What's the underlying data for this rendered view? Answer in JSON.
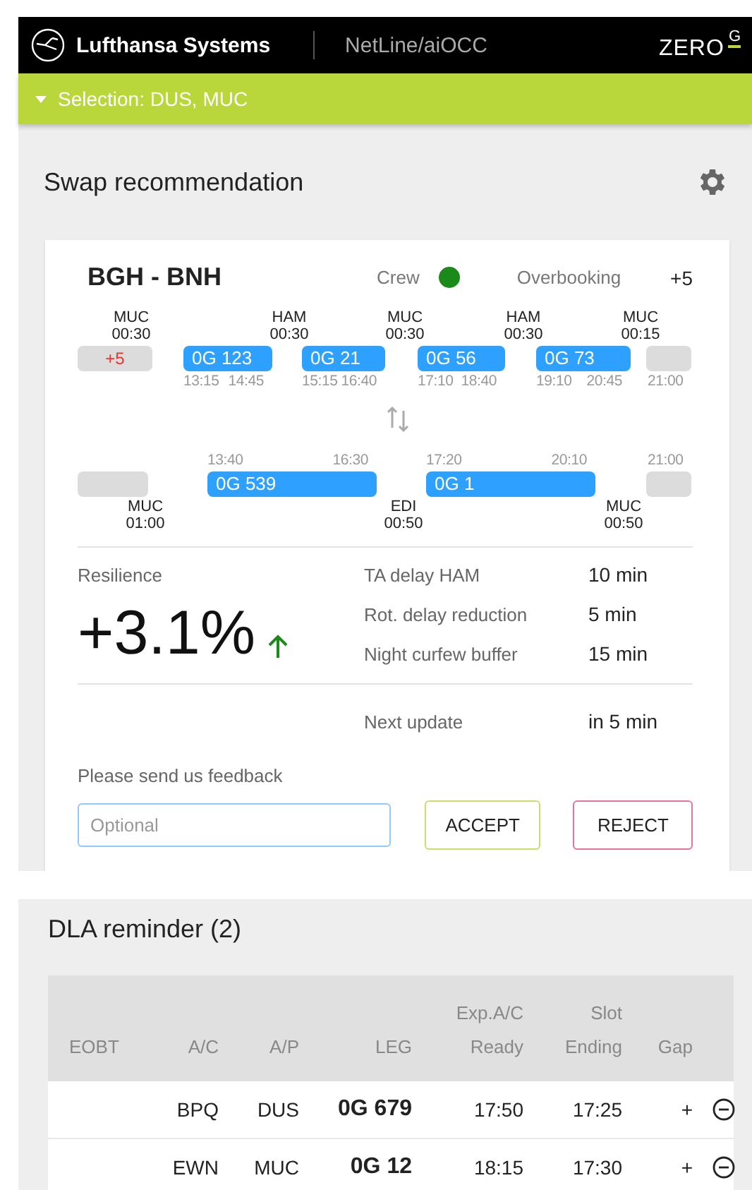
{
  "header": {
    "brand": "Lufthansa Systems",
    "product": "NetLine/aiOCC",
    "logo_text": "ZERO",
    "logo_mark": "G"
  },
  "selection_bar": {
    "label": "Selection: DUS, MUC",
    "expanded": true
  },
  "swap_panel": {
    "title": "Swap recommendation",
    "card": {
      "route": "BGH - BNH",
      "crew": {
        "label": "Crew",
        "color": "#1a8a1a"
      },
      "overbooking_label": "Overbooking",
      "overbooking_value": "+5",
      "top_rotation": {
        "start_badge": "+5",
        "end_time": "21:00",
        "stations": [
          {
            "code": "MUC",
            "time": "00:30"
          },
          {
            "code": "HAM",
            "time": "00:30"
          },
          {
            "code": "MUC",
            "time": "00:30"
          },
          {
            "code": "HAM",
            "time": "00:30"
          },
          {
            "code": "MUC",
            "time": "00:15"
          }
        ],
        "flights": [
          {
            "number": "0G 123",
            "dep": "13:15",
            "arr": "14:45"
          },
          {
            "number": "0G 21",
            "dep": "15:15",
            "arr": "16:40"
          },
          {
            "number": "0G 56",
            "dep": "17:10",
            "arr": "18:40"
          },
          {
            "number": "0G 73",
            "dep": "19:10",
            "arr": "20:45"
          }
        ]
      },
      "bottom_rotation": {
        "end_time": "21:00",
        "stations": [
          {
            "code": "MUC",
            "time": "01:00"
          },
          {
            "code": "EDI",
            "time": "00:50"
          },
          {
            "code": "MUC",
            "time": "00:50"
          }
        ],
        "flights": [
          {
            "number": "0G 539",
            "dep": "13:40",
            "arr": "16:30"
          },
          {
            "number": "0G 1",
            "dep": "17:20",
            "arr": "20:10"
          }
        ]
      },
      "resilience_label": "Resilience",
      "resilience_value": "+3.1%",
      "metrics": [
        {
          "label": "TA delay HAM",
          "value": "10 min"
        },
        {
          "label": "Rot. delay reduction",
          "value": "5 min"
        },
        {
          "label": "Night curfew buffer",
          "value": "15 min"
        }
      ],
      "next_update": {
        "label": "Next update",
        "value": "in 5 min"
      },
      "feedback_label": "Please send us feedback",
      "feedback_placeholder": "Optional",
      "accept": "ACCEPT",
      "reject": "REJECT"
    }
  },
  "dla_panel": {
    "title": "DLA reminder (2)",
    "columns": [
      [
        "EOBT"
      ],
      [
        "A/C"
      ],
      [
        "A/P"
      ],
      [
        "LEG"
      ],
      [
        "Exp.A/C",
        "Ready"
      ],
      [
        "Slot",
        "Ending"
      ],
      [
        "Gap"
      ]
    ],
    "rows": [
      {
        "ac": "BPQ",
        "ap": "DUS",
        "leg": "0G 679",
        "ready": "17:50",
        "slot": "17:25",
        "gap": "+"
      },
      {
        "ac": "EWN",
        "ap": "MUC",
        "leg": "0G 12",
        "ready": "18:15",
        "slot": "17:30",
        "gap": "+"
      }
    ]
  }
}
